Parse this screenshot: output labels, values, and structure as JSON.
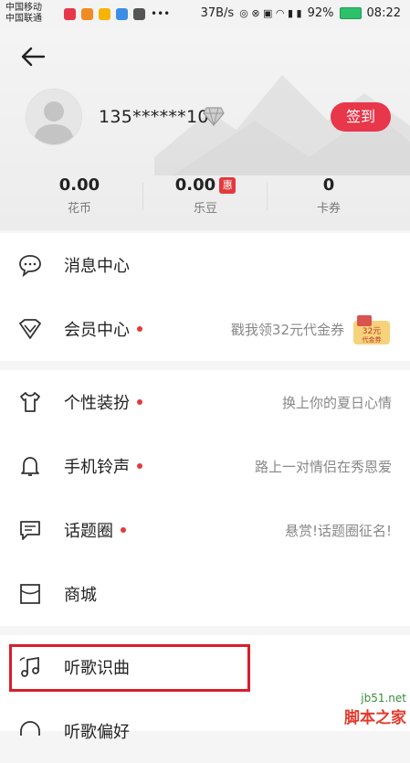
{
  "status_bar": {
    "carrier1": "中国移动",
    "carrier2": "中国联通",
    "speed": "37B/s",
    "battery": "92%",
    "time": "08:22"
  },
  "profile": {
    "username": "135******10",
    "signin_label": "签到"
  },
  "stats": [
    {
      "value": "0.00",
      "label": "花币"
    },
    {
      "value": "0.00",
      "label": "乐豆",
      "badge": "惠"
    },
    {
      "value": "0",
      "label": "卡券"
    }
  ],
  "menu": {
    "messages": {
      "label": "消息中心"
    },
    "vip": {
      "label": "会员中心",
      "hint": "戳我领32元代金券"
    },
    "theme": {
      "label": "个性装扮",
      "hint": "换上你的夏日心情"
    },
    "ringtone": {
      "label": "手机铃声",
      "hint": "路上一对情侣在秀恩爱"
    },
    "topics": {
      "label": "话题圈",
      "hint": "悬赏!话题圈征名!"
    },
    "store": {
      "label": "商城"
    },
    "recognize": {
      "label": "听歌识曲"
    },
    "preference": {
      "label": "听歌偏好"
    }
  },
  "watermark": {
    "line1": "jb51.net",
    "line2": "脚本之家"
  },
  "colors": {
    "accent": "#e8364a",
    "highlight_box": "#d81e2a"
  }
}
